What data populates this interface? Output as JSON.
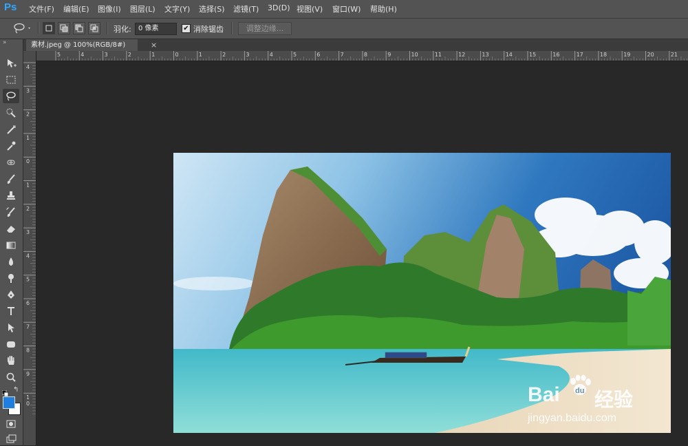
{
  "app": {
    "logo": "Ps"
  },
  "menu": [
    {
      "label": "文件(F)"
    },
    {
      "label": "编辑(E)"
    },
    {
      "label": "图像(I)"
    },
    {
      "label": "图层(L)"
    },
    {
      "label": "文字(Y)"
    },
    {
      "label": "选择(S)"
    },
    {
      "label": "滤镜(T)"
    },
    {
      "label": "3D(D)"
    },
    {
      "label": "视图(V)"
    },
    {
      "label": "窗口(W)"
    },
    {
      "label": "帮助(H)"
    }
  ],
  "options": {
    "feather_label": "羽化:",
    "feather_value": "0 像素",
    "antialias_checked": "✔",
    "antialias_label": "消除锯齿",
    "refine_edge_label": "调整边缘..."
  },
  "document": {
    "tab_title": "素材.jpeg @ 100%(RGB/8#)",
    "close_glyph": "×"
  },
  "ruler": {
    "h_labels": [
      "5",
      "4",
      "3",
      "2",
      "1",
      "0",
      "1",
      "2",
      "3",
      "4",
      "5",
      "6",
      "7",
      "8",
      "9",
      "10",
      "11",
      "12",
      "13",
      "14",
      "15",
      "16",
      "17",
      "18",
      "19",
      "20",
      "21"
    ],
    "v_labels": [
      "4",
      "3",
      "2",
      "1",
      "0",
      "1",
      "2",
      "3",
      "4",
      "5",
      "6",
      "7",
      "8",
      "9",
      "1 0"
    ]
  },
  "watermark": {
    "logo_text": "Bai",
    "logo_text2": "du",
    "logo_cn": "经验",
    "url": "jingyan.baidu.com"
  },
  "colors": {
    "foreground": "#1f7fe0",
    "background": "#ffffff",
    "accent": "#31a8ff"
  },
  "icons": [
    "move-icon",
    "marquee-icon",
    "lasso-icon",
    "quick-select-icon",
    "crop-icon",
    "eyedropper-icon",
    "healing-brush-icon",
    "brush-icon",
    "clone-stamp-icon",
    "history-brush-icon",
    "eraser-icon",
    "gradient-icon",
    "blur-icon",
    "dodge-icon",
    "pen-icon",
    "type-icon",
    "path-select-icon",
    "shape-icon",
    "hand-icon",
    "zoom-icon"
  ]
}
